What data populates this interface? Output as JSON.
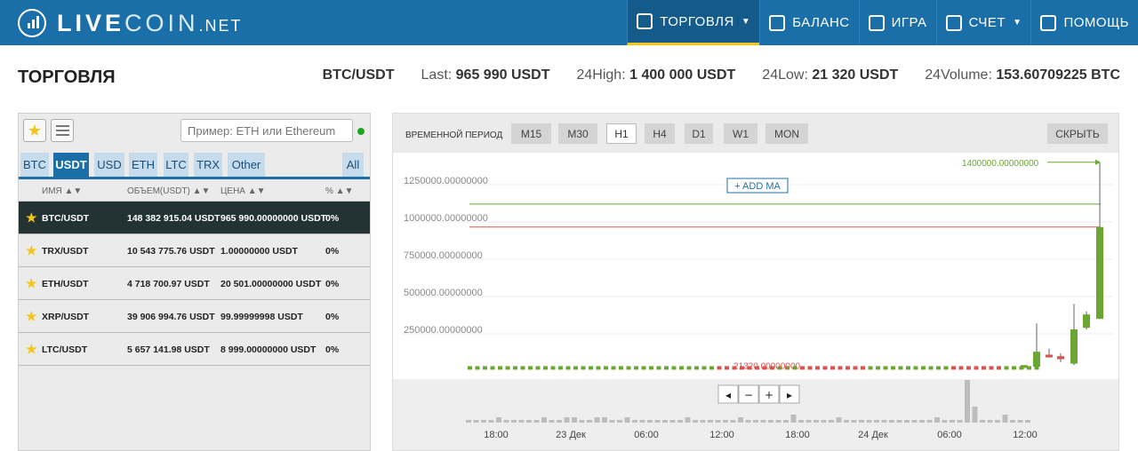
{
  "header": {
    "logo": {
      "live": "LIVE",
      "coin": "COIN",
      "net": ".NET"
    },
    "nav": [
      {
        "label": "ТОРГОВЛЯ",
        "icon": "chart-icon",
        "active": true,
        "caret": true
      },
      {
        "label": "БАЛАНС",
        "icon": "wallet-icon",
        "active": false,
        "caret": false
      },
      {
        "label": "ИГРА",
        "icon": "grid-icon",
        "active": false,
        "caret": false
      },
      {
        "label": "СЧЕТ",
        "icon": "account-icon",
        "active": false,
        "caret": true
      },
      {
        "label": "ПОМОЩЬ",
        "icon": "headset-icon",
        "active": false,
        "caret": false
      }
    ]
  },
  "page": {
    "title": "ТОРГОВЛЯ",
    "pair": "BTC/USDT",
    "last_label": "Last:",
    "last_value": "965 990 USDT",
    "high_label": "24High:",
    "high_value": "1 400 000 USDT",
    "low_label": "24Low:",
    "low_value": "21 320 USDT",
    "volume_label": "24Volume:",
    "volume_value": "153.60709225 BTC"
  },
  "market": {
    "search_placeholder": "Пример: ETH или Ethereum",
    "tabs": [
      "BTC",
      "USDT",
      "USD",
      "ETH",
      "LTC",
      "TRX",
      "Other",
      "All"
    ],
    "active_tab": "USDT",
    "columns": {
      "name": "ИМЯ ▲▼",
      "volume": "ОБЪЕМ(USDT) ▲▼",
      "price": "ЦЕНА ▲▼",
      "change": "% ▲▼"
    },
    "rows": [
      {
        "name": "BTC/USDT",
        "volume": "148 382 915.04 USDT",
        "price": "965 990.00000000 USDT",
        "change": "0%"
      },
      {
        "name": "TRX/USDT",
        "volume": "10 543 775.76 USDT",
        "price": "1.00000000 USDT",
        "change": "0%"
      },
      {
        "name": "ETH/USDT",
        "volume": "4 718 700.97 USDT",
        "price": "20 501.00000000 USDT",
        "change": "0%"
      },
      {
        "name": "XRP/USDT",
        "volume": "39 906 994.76 USDT",
        "price": "99.99999998 USDT",
        "change": "0%"
      },
      {
        "name": "LTC/USDT",
        "volume": "5 657 141.98 USDT",
        "price": "8 999.00000000 USDT",
        "change": "0%"
      }
    ]
  },
  "chart_panel": {
    "period_label": "ВРЕМЕННОЙ ПЕРИОД",
    "periods": [
      "M15",
      "M30",
      "H1",
      "H4",
      "D1",
      "W1",
      "MON"
    ],
    "active_period": "H1",
    "hide_label": "СКРЫТЬ",
    "add_ma_label": "+ ADD MA",
    "nav_buttons": [
      "◂",
      "−",
      "+",
      "▸"
    ]
  },
  "chart_data": {
    "type": "candlestick",
    "y_tick_labels": [
      "1250000.00000000",
      "1000000.00000000",
      "750000.00000000",
      "500000.00000000",
      "250000.00000000"
    ],
    "y_ticks": [
      1250000,
      1000000,
      750000,
      500000,
      250000
    ],
    "ylim": [
      0,
      1400000
    ],
    "x_tick_labels": [
      "18:00",
      "23 Дек",
      "06:00",
      "12:00",
      "18:00",
      "24 Дек",
      "06:00",
      "12:00"
    ],
    "max_annotation": "1400000.00000000",
    "min_annotation": "21320.00000000",
    "green_line_value": 1120000,
    "red_line_value": 965990,
    "base_price": 21320,
    "late_candles": [
      {
        "open": 21320,
        "close": 40000,
        "high": 40000,
        "low": 21320,
        "up": true
      },
      {
        "open": 30000,
        "close": 130000,
        "high": 320000,
        "low": 30000,
        "up": true
      },
      {
        "open": 110000,
        "close": 100000,
        "high": 150000,
        "low": 90000,
        "up": false
      },
      {
        "open": 100000,
        "close": 80000,
        "high": 120000,
        "low": 60000,
        "up": false
      },
      {
        "open": 50000,
        "close": 280000,
        "high": 450000,
        "low": 40000,
        "up": true
      },
      {
        "open": 290000,
        "close": 380000,
        "high": 400000,
        "low": 280000,
        "up": true
      },
      {
        "open": 350000,
        "close": 965990,
        "high": 1400000,
        "low": 350000,
        "up": true
      }
    ],
    "volumes": [
      1,
      1,
      1,
      1,
      2,
      1,
      1,
      1,
      1,
      1,
      2,
      1,
      1,
      2,
      2,
      1,
      1,
      2,
      2,
      1,
      1,
      2,
      1,
      1,
      1,
      1,
      1,
      1,
      1,
      2,
      1,
      1,
      1,
      1,
      1,
      1,
      2,
      1,
      1,
      1,
      1,
      1,
      1,
      3,
      1,
      1,
      1,
      1,
      1,
      2,
      1,
      1,
      1,
      1,
      1,
      1,
      1,
      1,
      1,
      1,
      1,
      1,
      2,
      1,
      1,
      1,
      16,
      6,
      1,
      1,
      1,
      3,
      1,
      1,
      1
    ]
  },
  "colors": {
    "header": "#1b6fa8",
    "up": "#6aa632",
    "down": "#d9534f",
    "accent": "#f5c518"
  }
}
